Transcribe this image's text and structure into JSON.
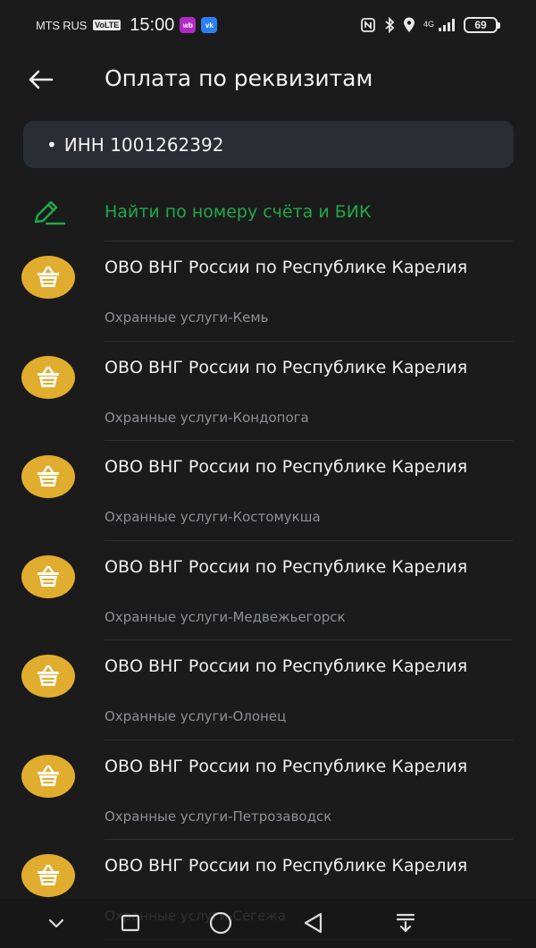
{
  "status_bar": {
    "carrier": "MTS RUS",
    "volte": "VoLTE",
    "time": "15:00",
    "app_badges": [
      "wb",
      "vk"
    ],
    "network": "4G",
    "battery": "69",
    "icons": [
      "nfc-icon",
      "bluetooth-icon",
      "location-icon",
      "signal-icon"
    ]
  },
  "header": {
    "title": "Оплата по реквизитам",
    "back_icon": "arrow-left-icon"
  },
  "search": {
    "value": "ИНН 1001262392"
  },
  "find_action": {
    "label": "Найти по номеру счёта и БИК",
    "icon": "pencil-icon",
    "color": "#20a84a"
  },
  "results": [
    {
      "title": "ОВО ВНГ России по Республике Карелия",
      "subtitle": "Охранные услуги-Кемь"
    },
    {
      "title": "ОВО ВНГ России по Республике Карелия",
      "subtitle": "Охранные услуги-Кондопога"
    },
    {
      "title": "ОВО ВНГ России по Республике Карелия",
      "subtitle": "Охранные услуги-Костомукша"
    },
    {
      "title": "ОВО ВНГ России по Республике Карелия",
      "subtitle": "Охранные услуги-Медвежьегорск"
    },
    {
      "title": "ОВО ВНГ России по Республике Карелия",
      "subtitle": "Охранные услуги-Олонец"
    },
    {
      "title": "ОВО ВНГ России по Республике Карелия",
      "subtitle": "Охранные услуги-Петрозаводск"
    },
    {
      "title": "ОВО ВНГ России по Республике Карелия",
      "subtitle": "Охранные услуги-Сегежа"
    }
  ],
  "result_avatar": {
    "icon": "basket-icon",
    "color": "#e1ad2e"
  },
  "nav_bar": {
    "buttons": [
      "chevron-down-icon",
      "square-icon",
      "circle-icon",
      "triangle-back-icon",
      "download-tray-icon"
    ]
  }
}
